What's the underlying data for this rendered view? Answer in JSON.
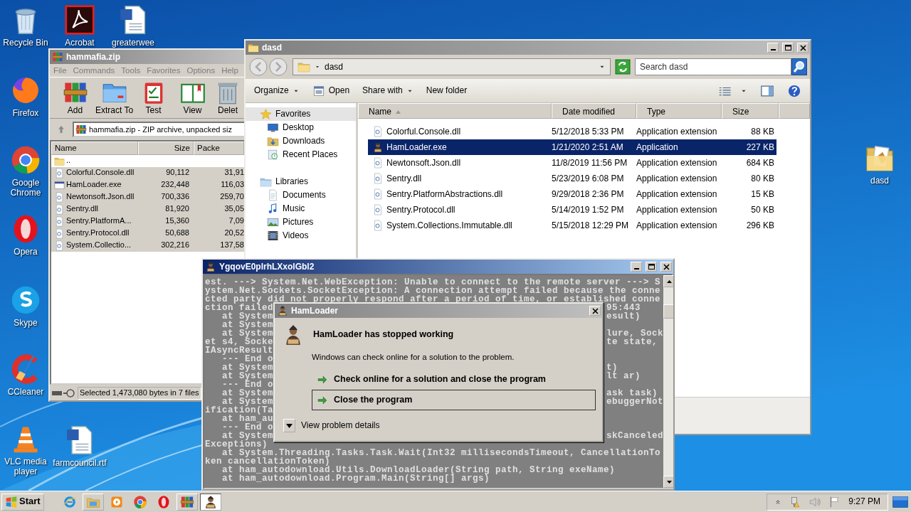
{
  "desktop_icons": [
    {
      "label": "Recycle Bin"
    },
    {
      "label": "Acrobat"
    },
    {
      "label": "greaterwee"
    },
    {
      "label": "Firefox"
    },
    {
      "label": "Google Chrome"
    },
    {
      "label": "Opera"
    },
    {
      "label": "Skype"
    },
    {
      "label": "CCleaner"
    },
    {
      "label": "VLC media player"
    },
    {
      "label": "farmcouncil.rtf"
    },
    {
      "label": "dasd"
    }
  ],
  "winrar": {
    "title": "hammafia.zip",
    "menu": [
      "File",
      "Commands",
      "Tools",
      "Favorites",
      "Options",
      "Help"
    ],
    "toolbar": [
      "Add",
      "Extract To",
      "Test",
      "View",
      "Delet"
    ],
    "address": "hammafia.zip - ZIP archive, unpacked siz",
    "columns": [
      "Name",
      "Size",
      "Packe"
    ],
    "rows": [
      {
        "name": "..",
        "size": "",
        "packed": "",
        "kind": "folder",
        "selected": false
      },
      {
        "name": "Colorful.Console.dll",
        "size": "90,112",
        "packed": "31,91",
        "kind": "library",
        "selected": true
      },
      {
        "name": "HamLoader.exe",
        "size": "232,448",
        "packed": "116,03",
        "kind": "application",
        "selected": true
      },
      {
        "name": "Newtonsoft.Json.dll",
        "size": "700,336",
        "packed": "259,70",
        "kind": "library",
        "selected": true
      },
      {
        "name": "Sentry.dll",
        "size": "81,920",
        "packed": "35,05",
        "kind": "library",
        "selected": true
      },
      {
        "name": "Sentry.PlatformA...",
        "size": "15,360",
        "packed": "7,09",
        "kind": "library",
        "selected": true
      },
      {
        "name": "Sentry.Protocol.dll",
        "size": "50,688",
        "packed": "20,52",
        "kind": "library",
        "selected": true
      },
      {
        "name": "System.Collectio...",
        "size": "302,216",
        "packed": "137,58",
        "kind": "library",
        "selected": true
      }
    ],
    "status": "Selected 1,473,080 bytes in 7 files"
  },
  "explorer": {
    "title": "dasd",
    "path": "dasd",
    "search": {
      "placeholder": "Search dasd"
    },
    "commands": [
      {
        "label": "Organize",
        "menu": true
      },
      {
        "label": "Open",
        "menu": false
      },
      {
        "label": "Share with",
        "menu": true
      },
      {
        "label": "New folder",
        "menu": false
      }
    ],
    "nav": [
      {
        "label": "Favorites",
        "selected": true,
        "children": [
          {
            "label": "Desktop",
            "selected": false
          },
          {
            "label": "Downloads",
            "selected": false
          },
          {
            "label": "Recent Places",
            "selected": false
          }
        ]
      },
      {
        "label": "Libraries",
        "selected": false,
        "children": [
          {
            "label": "Documents",
            "selected": false
          },
          {
            "label": "Music",
            "selected": false
          },
          {
            "label": "Pictures",
            "selected": false
          },
          {
            "label": "Videos",
            "selected": false
          }
        ]
      }
    ],
    "columns": [
      "Name",
      "Date modified",
      "Type",
      "Size"
    ],
    "rows": [
      {
        "name": "Colorful.Console.dll",
        "date": "5/12/2018 5:33 PM",
        "type": "Application extension",
        "size": "88 KB",
        "kind": "library",
        "selected": false
      },
      {
        "name": "HamLoader.exe",
        "date": "1/21/2020 2:51 AM",
        "type": "Application",
        "size": "227 KB",
        "kind": "application",
        "selected": true
      },
      {
        "name": "Newtonsoft.Json.dll",
        "date": "11/8/2019 11:56 PM",
        "type": "Application extension",
        "size": "684 KB",
        "kind": "library",
        "selected": false
      },
      {
        "name": "Sentry.dll",
        "date": "5/23/2019 6:08 PM",
        "type": "Application extension",
        "size": "80 KB",
        "kind": "library",
        "selected": false
      },
      {
        "name": "Sentry.PlatformAbstractions.dll",
        "date": "9/29/2018 2:36 PM",
        "type": "Application extension",
        "size": "15 KB",
        "kind": "library",
        "selected": false
      },
      {
        "name": "Sentry.Protocol.dll",
        "date": "5/14/2019 1:52 PM",
        "type": "Application extension",
        "size": "50 KB",
        "kind": "library",
        "selected": false
      },
      {
        "name": "System.Collections.Immutable.dll",
        "date": "5/15/2018 12:29 PM",
        "type": "Application extension",
        "size": "296 KB",
        "kind": "library",
        "selected": false
      }
    ]
  },
  "console": {
    "title": "YgqovE0plrhLXxolGbl2",
    "lines": [
      {
        "left": "est. ---> System.Net.WebException: Unable to connect to the remote server ---> S"
      },
      {
        "left": "ystem.Net.Sockets.SocketException: A connection attempt failed because the conne"
      },
      {
        "left": "cted party did not properly respond after a period of time, or established conne"
      },
      {
        "left": "ction failed",
        "right": "95:443"
      },
      {
        "left": "   at System",
        "right": "esult)"
      },
      {
        "left": "   at System"
      },
      {
        "left": "   at System",
        "right": "lure, Sock"
      },
      {
        "left": "et s4, Socke",
        "right": "te state,"
      },
      {
        "left": "IAsyncResult"
      },
      {
        "left": "   --- End o"
      },
      {
        "left": "   at System",
        "right": "t)"
      },
      {
        "left": "   at System",
        "right": "lt ar)"
      },
      {
        "left": "   --- End o"
      },
      {
        "left": "   at System",
        "right": "ask task)"
      },
      {
        "left": "   at System",
        "right": "ebuggerNot"
      },
      {
        "left": "ification(Ta"
      },
      {
        "left": "   at ham_au"
      },
      {
        "left": "   --- End o"
      },
      {
        "left": "   at System",
        "right": "skCanceled"
      },
      {
        "left": "Exceptions)"
      },
      {
        "left": "   at System.Threading.Tasks.Task.Wait(Int32 millisecondsTimeout, CancellationTo"
      },
      {
        "left": "ken cancellationToken)"
      },
      {
        "left": "   at ham_autodownload.Utils.DownloadLoader(String path, String exeName)"
      },
      {
        "left": "   at ham_autodownload.Program.Main(String[] args)"
      }
    ]
  },
  "dialog": {
    "title": "HamLoader",
    "heading": "HamLoader has stopped working",
    "message": "Windows can check online for a solution to the problem.",
    "options": [
      {
        "label": "Check online for a solution and close the program",
        "focused": false
      },
      {
        "label": "Close the program",
        "focused": true
      }
    ],
    "details": "View problem details"
  },
  "taskbar": {
    "start": "Start",
    "apps": [
      {
        "kind": "launcher",
        "active": false
      },
      {
        "kind": "window",
        "active": false
      },
      {
        "kind": "launcher",
        "active": false
      },
      {
        "kind": "launcher",
        "active": false
      },
      {
        "kind": "launcher",
        "active": false
      },
      {
        "kind": "window",
        "active": false
      },
      {
        "kind": "window",
        "active": true
      }
    ],
    "time": "9:27 PM"
  }
}
